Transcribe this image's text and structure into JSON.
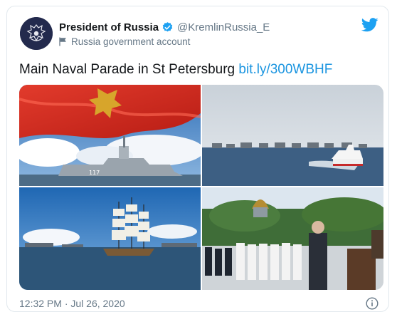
{
  "account": {
    "display_name": "President of Russia",
    "handle": "@KremlinRussia_E",
    "label": "Russia government account"
  },
  "tweet": {
    "text": "Main Naval Parade in St Petersburg ",
    "link": "bit.ly/300WBHF",
    "timestamp": "12:32 PM · Jul 26, 2020"
  },
  "media": {
    "ship_hull_number": "117"
  },
  "colors": {
    "link": "#1b95e0",
    "verified_badge": "#1da1f2",
    "avatar_bg": "#232a4d",
    "secondary_text": "#657786"
  },
  "icons": [
    "emblem-icon",
    "verified-icon",
    "flag-icon",
    "twitter-bird-icon",
    "info-icon"
  ]
}
